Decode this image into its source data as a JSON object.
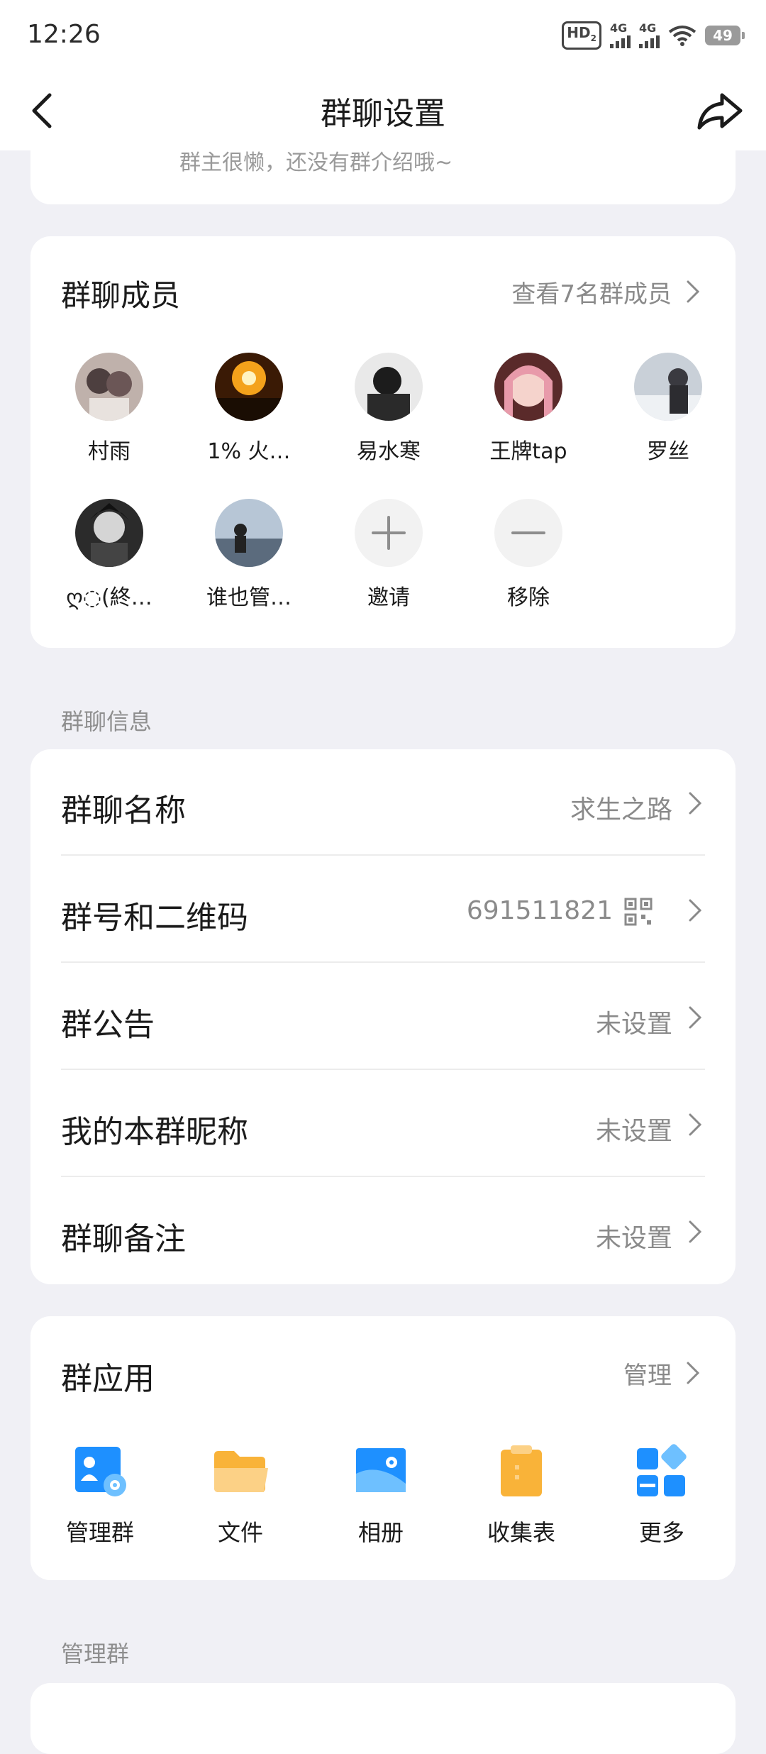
{
  "status_bar": {
    "time": "12:26",
    "hd_label": "HD",
    "hd_sub": "2",
    "sim_labels": [
      "4G",
      "4G"
    ],
    "battery": "49"
  },
  "header": {
    "title": "群聊设置",
    "back_icon": "chevron-left-icon",
    "share_icon": "share-arrow-icon"
  },
  "intro": {
    "text": "群主很懒，还没有群介绍哦~"
  },
  "members": {
    "label": "群聊成员",
    "view_all": "查看7名群成员",
    "items": [
      {
        "name": "村雨",
        "color": "#6b5b5b"
      },
      {
        "name": "1%  火…",
        "color": "#e07a1a"
      },
      {
        "name": "易水寒",
        "color": "#2a2a2a"
      },
      {
        "name": "王牌tap",
        "color": "#d98a9a"
      },
      {
        "name": "罗丝",
        "color": "#7f8a99"
      },
      {
        "name": "ღ◌(終…",
        "color": "#3a3a3a"
      },
      {
        "name": "谁也管…",
        "color": "#8fa3b8"
      }
    ],
    "invite": "邀请",
    "remove": "移除"
  },
  "info_section": {
    "label": "群聊信息",
    "rows": [
      {
        "label": "群聊名称",
        "value": "求生之路"
      },
      {
        "label": "群号和二维码",
        "value": "691511821"
      },
      {
        "label": "群公告",
        "value": "未设置"
      },
      {
        "label": "我的本群昵称",
        "value": "未设置"
      },
      {
        "label": "群聊备注",
        "value": "未设置"
      }
    ]
  },
  "apps": {
    "label": "群应用",
    "manage": "管理",
    "items": [
      {
        "name": "管理群",
        "icon": "group-admin-icon"
      },
      {
        "name": "文件",
        "icon": "folder-icon"
      },
      {
        "name": "相册",
        "icon": "album-icon"
      },
      {
        "name": "收集表",
        "icon": "clipboard-icon"
      },
      {
        "name": "更多",
        "icon": "more-apps-icon"
      }
    ]
  },
  "manage_section": {
    "label": "管理群"
  },
  "colors": {
    "background": "#f0f0f5",
    "accent_blue": "#1e90ff",
    "folder_orange": "#f9b339"
  }
}
